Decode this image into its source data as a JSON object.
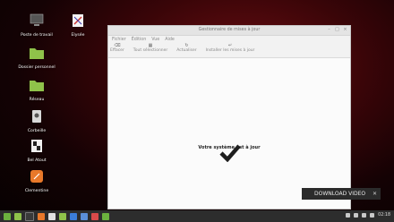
{
  "desktop": {
    "icons": [
      {
        "label": "Poste de travail"
      },
      {
        "label": "Dossier personnel"
      },
      {
        "label": "Réseau"
      },
      {
        "label": "Corbeille"
      },
      {
        "label": "Bel Atout"
      },
      {
        "label": "Clementine"
      },
      {
        "label": "Elysée"
      }
    ]
  },
  "window": {
    "title": "Gestionnaire de mises à jour",
    "controls": {
      "minimize": "–",
      "maximize": "□",
      "close": "×"
    },
    "menu": [
      "Fichier",
      "Édition",
      "Vue",
      "Aide"
    ],
    "toolbar": [
      {
        "icon": "⌫",
        "label": "Effacer"
      },
      {
        "icon": "▦",
        "label": "Tout sélectionner"
      },
      {
        "icon": "↻",
        "label": "Actualiser"
      },
      {
        "icon": "↵",
        "label": "Installer les mises à jour"
      }
    ],
    "status": "Votre système est à jour"
  },
  "overlay": {
    "download_label": "DOWNLOAD VIDEO",
    "close": "✕"
  },
  "taskbar": {
    "clock": "02:18"
  }
}
